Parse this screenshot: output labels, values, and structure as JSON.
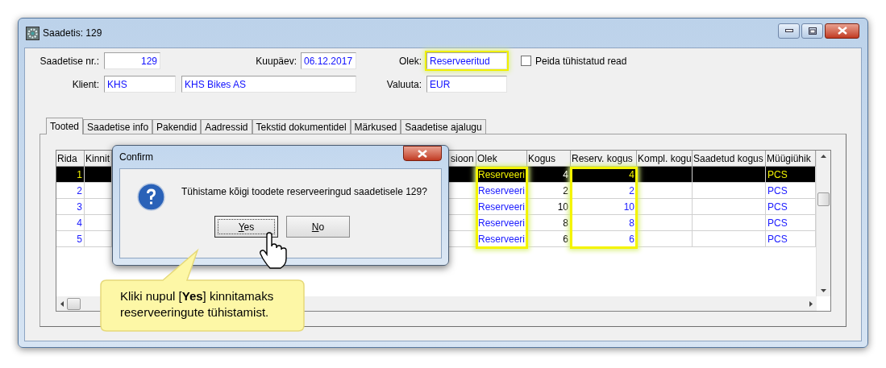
{
  "window": {
    "title": "Saadetis: 129"
  },
  "form": {
    "shipment_no": {
      "label": "Saadetise nr.:",
      "value": "129"
    },
    "date": {
      "label": "Kuupäev:",
      "value": "06.12.2017"
    },
    "status": {
      "label": "Olek:",
      "value": "Reserveeritud",
      "highlighted": true
    },
    "hide_cancelled": {
      "label": "Peida tühistatud read",
      "checked": false
    },
    "client": {
      "label": "Klient:",
      "code": "KHS",
      "name": "KHS Bikes AS"
    },
    "currency": {
      "label": "Valuuta:",
      "value": "EUR"
    }
  },
  "tabs": [
    {
      "label": "Tooted",
      "selected": true
    },
    {
      "label": "Saadetise info",
      "selected": false
    },
    {
      "label": "Pakendid",
      "selected": false
    },
    {
      "label": "Aadressid",
      "selected": false
    },
    {
      "label": "Tekstid dokumentidel",
      "selected": false
    },
    {
      "label": "Märkused",
      "selected": false
    },
    {
      "label": "Saadetise ajalugu",
      "selected": false
    }
  ],
  "table": {
    "columns": [
      {
        "label": "Rida",
        "highlighted": false
      },
      {
        "label": "Kinnit",
        "highlighted": false
      },
      {
        "label": "sioon",
        "highlighted": false
      },
      {
        "label": "Olek",
        "highlighted": true
      },
      {
        "label": "Kogus",
        "highlighted": false
      },
      {
        "label": "Reserv. kogus",
        "highlighted": true
      },
      {
        "label": "Kompl. kogu",
        "highlighted": false
      },
      {
        "label": "Saadetud kogus",
        "highlighted": false
      },
      {
        "label": "Müügiühik",
        "highlighted": false
      }
    ],
    "rows": [
      {
        "rida": "1",
        "olek": "Reserveeri",
        "kogus": "4",
        "reserv_kogus": "4",
        "muugiuhik": "PCS",
        "selected": true
      },
      {
        "rida": "2",
        "olek": "Reserveeri",
        "kogus": "2",
        "reserv_kogus": "2",
        "muugiuhik": "PCS",
        "selected": false
      },
      {
        "rida": "3",
        "olek": "Reserveeri",
        "kogus": "10",
        "reserv_kogus": "10",
        "muugiuhik": "PCS",
        "selected": false
      },
      {
        "rida": "4",
        "olek": "Reserveeri",
        "kogus": "8",
        "reserv_kogus": "8",
        "muugiuhik": "PCS",
        "selected": false
      },
      {
        "rida": "5",
        "olek": "Reserveeri",
        "kogus": "6",
        "reserv_kogus": "6",
        "muugiuhik": "PCS",
        "selected": false
      }
    ]
  },
  "dialog": {
    "title": "Confirm",
    "message": "Tühistame kõigi toodete reserveeringud saadetisele 129?",
    "buttons": [
      {
        "label": "Yes",
        "focused": true
      },
      {
        "label": "No",
        "focused": false
      }
    ]
  },
  "callout": {
    "text": "Kliki nupul [**Yes**] kinnitamaks reserveeringute tühistamist."
  }
}
